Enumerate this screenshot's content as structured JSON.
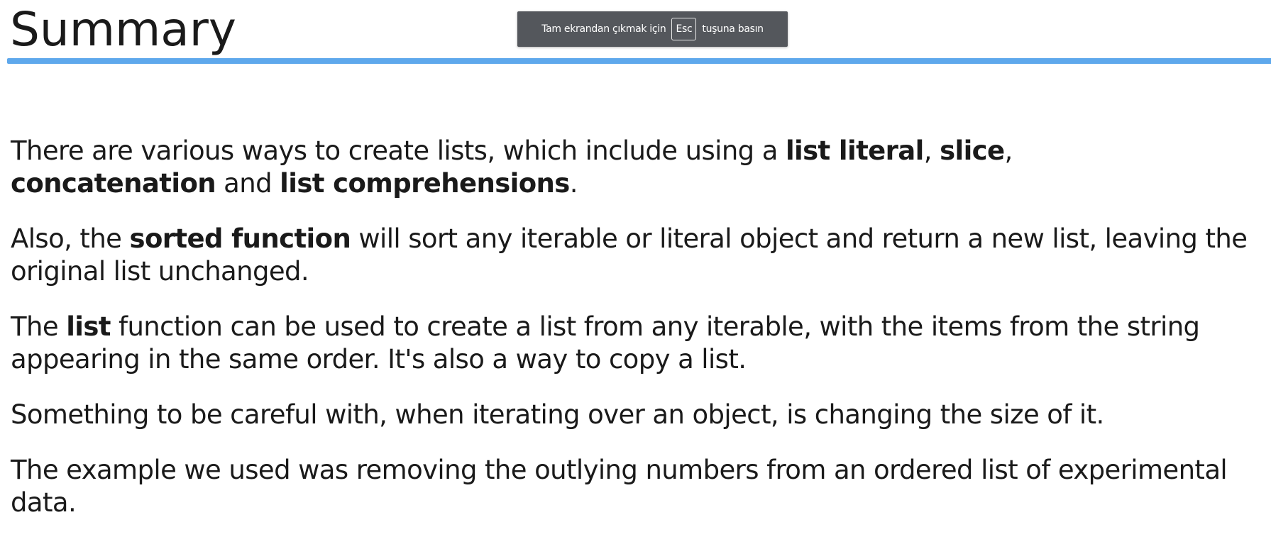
{
  "slide": {
    "title": "Summary",
    "paragraphs": [
      {
        "segments": [
          {
            "text": "There are various ways to create lists, which include using a ",
            "bold": false
          },
          {
            "text": "list literal",
            "bold": true
          },
          {
            "text": ", ",
            "bold": false
          },
          {
            "text": "slice",
            "bold": true
          },
          {
            "text": ", ",
            "bold": false
          },
          {
            "text": "concatenation",
            "bold": true
          },
          {
            "text": " and ",
            "bold": false
          },
          {
            "text": "list comprehensions",
            "bold": true
          },
          {
            "text": ".",
            "bold": false
          }
        ]
      },
      {
        "segments": [
          {
            "text": "Also, the ",
            "bold": false
          },
          {
            "text": "sorted function",
            "bold": true
          },
          {
            "text": " will sort any iterable or literal object and return a new list, leaving the original list unchanged.",
            "bold": false
          }
        ]
      },
      {
        "segments": [
          {
            "text": "The ",
            "bold": false
          },
          {
            "text": "list",
            "bold": true
          },
          {
            "text": " function can be used to create a list from any iterable, with the items from the string appearing in the same order. It's also a way to copy a list.",
            "bold": false
          }
        ]
      },
      {
        "segments": [
          {
            "text": "Something to be careful with, when iterating over an object, is changing the size of it.",
            "bold": false
          }
        ]
      },
      {
        "segments": [
          {
            "text": "The example we used was removing the outlying numbers from an ordered list of experimental data.",
            "bold": false
          }
        ]
      }
    ]
  },
  "fullscreen_notice": {
    "prefix": "Tam ekrandan çıkmak için",
    "key": "Esc",
    "suffix": "tuşuna basın"
  },
  "colors": {
    "accent_rule": "#5ea8ec",
    "toast_background": "#54575c",
    "text": "#1a1a1a"
  }
}
